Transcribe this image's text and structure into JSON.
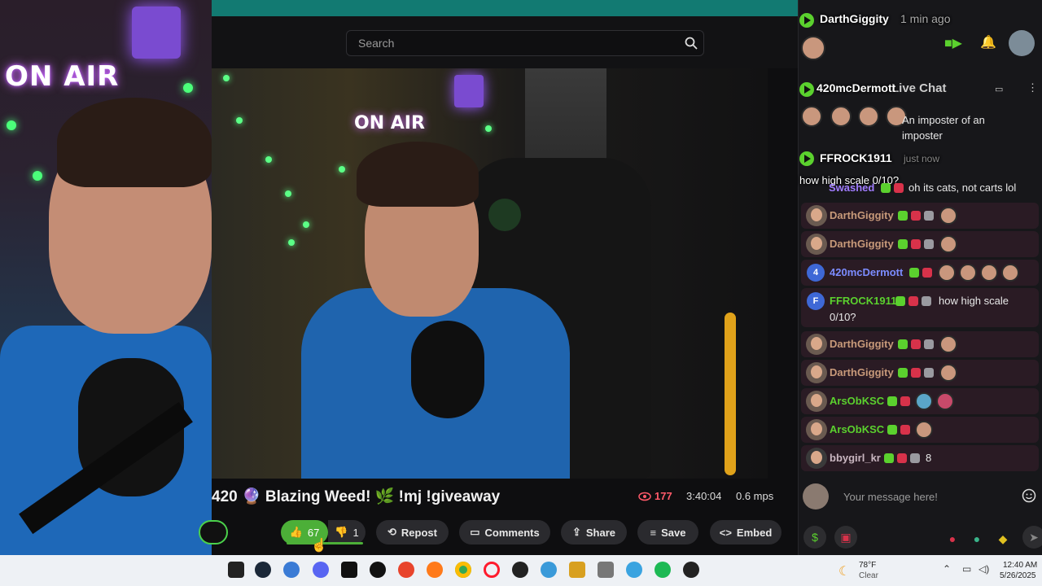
{
  "search": {
    "placeholder": "Search"
  },
  "stream": {
    "title": "420 🔮 Blazing Weed! 🌿 !mj !giveaway",
    "viewers": "177",
    "uptime": "3:40:04",
    "mps": "0.6 mps"
  },
  "actions": {
    "like_count": "67",
    "dislike_count": "1",
    "repost": "Repost",
    "comments": "Comments",
    "share": "Share",
    "save": "Save",
    "embed": "Embed"
  },
  "chat": {
    "title": "Live Chat",
    "notifications": [
      {
        "user": "DarthGiggity",
        "time": "1 min ago"
      },
      {
        "user": "420mcDermott",
        "text": "An imposter of an imposter"
      },
      {
        "user": "FFROCK1911",
        "time": "just now",
        "text": "how high scale 0/10?"
      }
    ],
    "messages": [
      {
        "user": "Swashed",
        "text": "oh its cats, not carts lol",
        "color": "#a07cff"
      },
      {
        "user": "DarthGiggity",
        "text": "",
        "color": "#c89a7a"
      },
      {
        "user": "DarthGiggity",
        "text": "",
        "color": "#c89a7a"
      },
      {
        "user": "420mcDermott",
        "initial": "4",
        "text": "",
        "color": "#7c8cff"
      },
      {
        "user": "FFROCK1911",
        "initial": "F",
        "text": "how high scale",
        "text2": "0/10?",
        "color": "#5bd12e"
      },
      {
        "user": "DarthGiggity",
        "text": "",
        "color": "#c89a7a"
      },
      {
        "user": "DarthGiggity",
        "text": "",
        "color": "#c89a7a"
      },
      {
        "user": "ArsObKSC",
        "text": "",
        "color": "#5bd12e"
      },
      {
        "user": "ArsObKSC",
        "text": "",
        "color": "#5bd12e"
      },
      {
        "user": "bbygirl_kr",
        "text": "8",
        "color": "#c9b6c0"
      }
    ],
    "input_placeholder": "Your message here!"
  },
  "overlay": {
    "sign": "ON AIR"
  },
  "taskbar": {
    "weather_temp": "78°F",
    "weather_desc": "Clear",
    "time": "12:40 AM",
    "date": "5/26/2025"
  },
  "colors": {
    "accent": "#4caf38",
    "topbar": "#127a72",
    "chat_bg": "#17171a"
  }
}
